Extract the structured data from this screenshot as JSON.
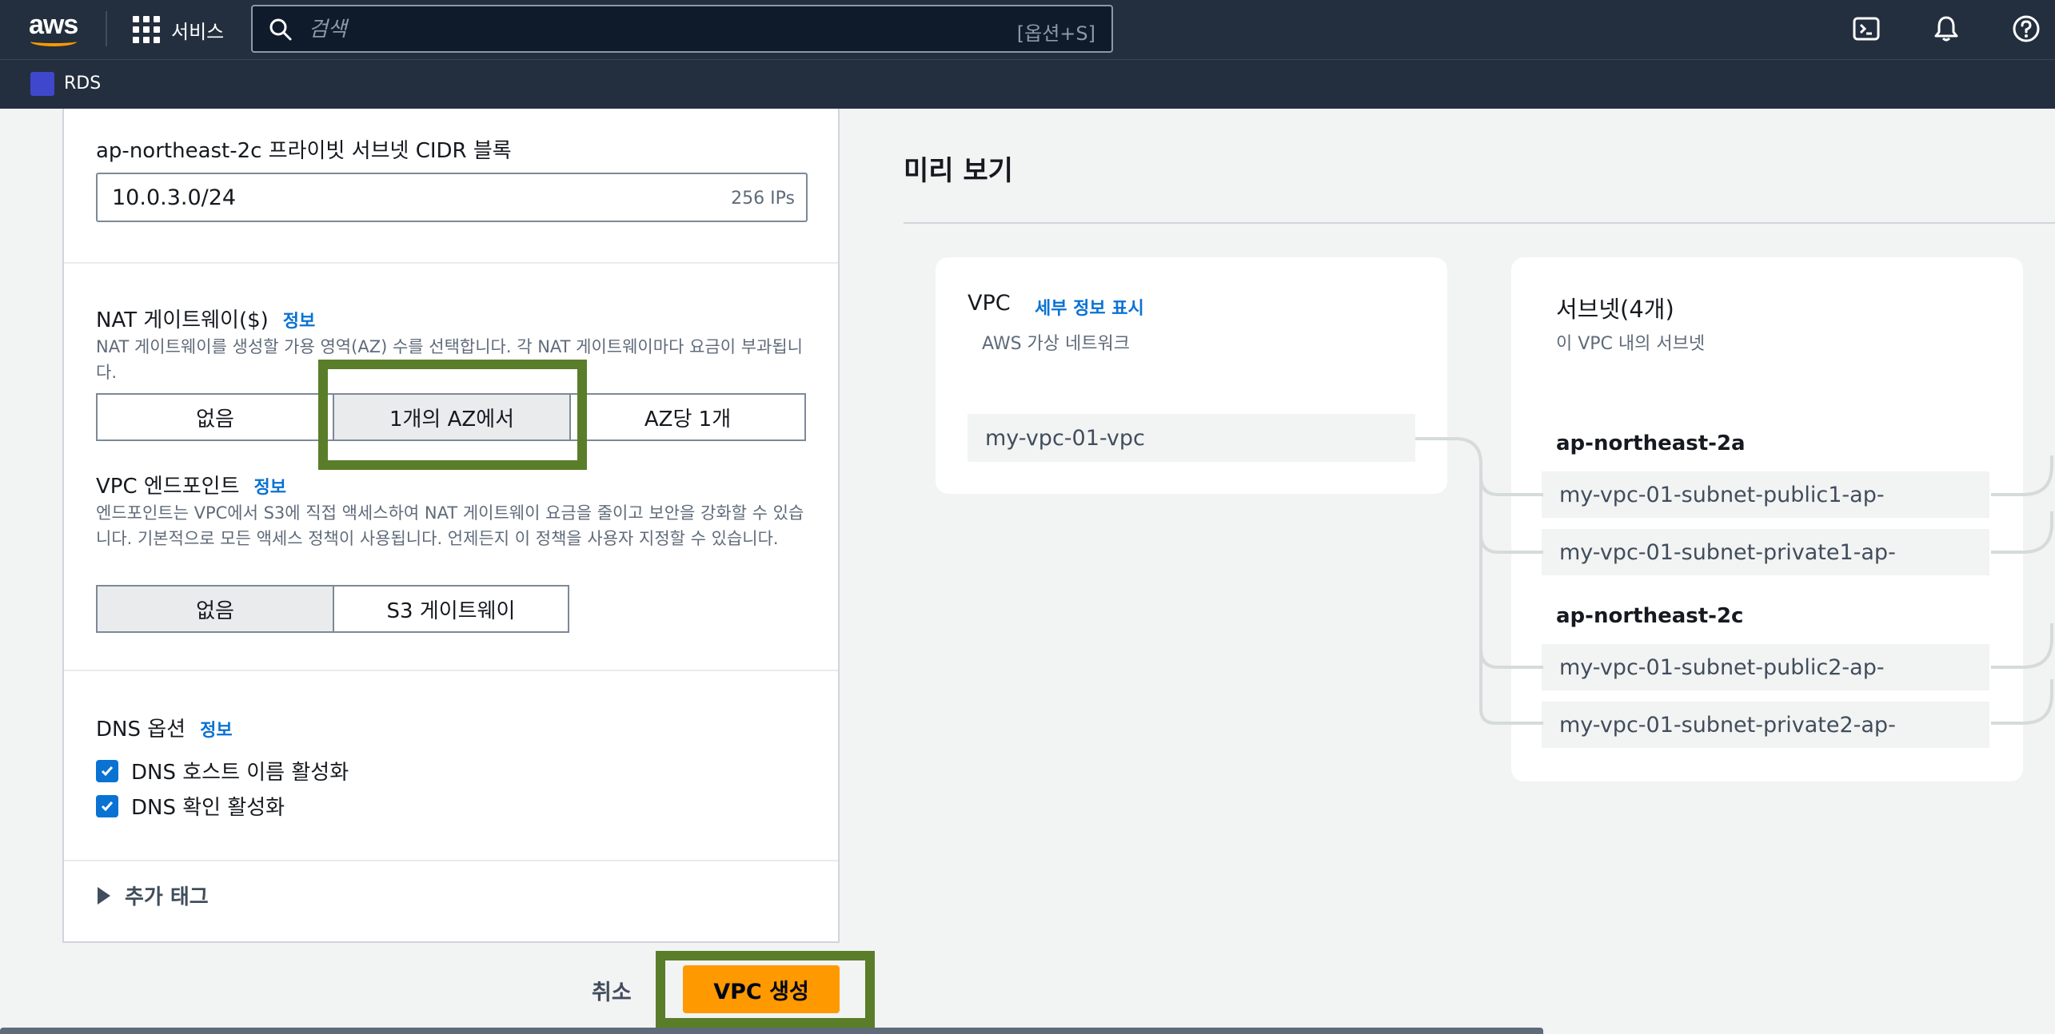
{
  "topnav": {
    "logo": "aws",
    "services_label": "서비스",
    "search_placeholder": "검색",
    "search_shortcut": "[옵션+S]",
    "icons": [
      "cloudshell-icon",
      "bell-icon",
      "help-icon"
    ]
  },
  "breadcrumb": {
    "service": "RDS"
  },
  "form": {
    "cidr": {
      "label": "ap-northeast-2c 프라이빗 서브넷 CIDR 블록",
      "value": "10.0.3.0/24",
      "ips": "256 IPs"
    },
    "nat": {
      "label": "NAT 게이트웨이($)",
      "info": "정보",
      "description": "NAT 게이트웨이를 생성할 가용 영역(AZ) 수를 선택합니다. 각 NAT 게이트웨이마다 요금이 부과됩니다.",
      "options": [
        "없음",
        "1개의 AZ에서",
        "AZ당 1개"
      ],
      "selected": "1개의 AZ에서"
    },
    "endpoint": {
      "label": "VPC 엔드포인트",
      "info": "정보",
      "description": "엔드포인트는 VPC에서 S3에 직접 액세스하여 NAT 게이트웨이 요금을 줄이고 보안을 강화할 수 있습니다. 기본적으로 모든 액세스 정책이 사용됩니다. 언제든지 이 정책을 사용자 지정할 수 있습니다.",
      "options": [
        "없음",
        "S3 게이트웨이"
      ],
      "selected": "없음"
    },
    "dns": {
      "label": "DNS 옵션",
      "info": "정보",
      "options": [
        {
          "label": "DNS 호스트 이름 활성화",
          "checked": true
        },
        {
          "label": "DNS 확인 활성화",
          "checked": true
        }
      ]
    },
    "tags": {
      "label": "추가 태그"
    }
  },
  "actions": {
    "cancel": "취소",
    "create": "VPC 생성"
  },
  "preview": {
    "title": "미리 보기",
    "vpc": {
      "title": "VPC",
      "detail_link": "세부 정보 표시",
      "description": "AWS 가상 네트워크",
      "name": "my-vpc-01-vpc"
    },
    "subnets": {
      "title": "서브넷(4개)",
      "description": "이 VPC 내의 서브넷",
      "zones": [
        {
          "name": "ap-northeast-2a",
          "subnets": [
            "my-vpc-01-subnet-public1-ap-",
            "my-vpc-01-subnet-private1-ap-"
          ]
        },
        {
          "name": "ap-northeast-2c",
          "subnets": [
            "my-vpc-01-subnet-public2-ap-",
            "my-vpc-01-subnet-private2-ap-"
          ]
        }
      ]
    }
  },
  "colors": {
    "nav_bg": "#232f3e",
    "link": "#0972d3",
    "primary_button": "#ff9900",
    "highlight": "#5a7d2a"
  }
}
